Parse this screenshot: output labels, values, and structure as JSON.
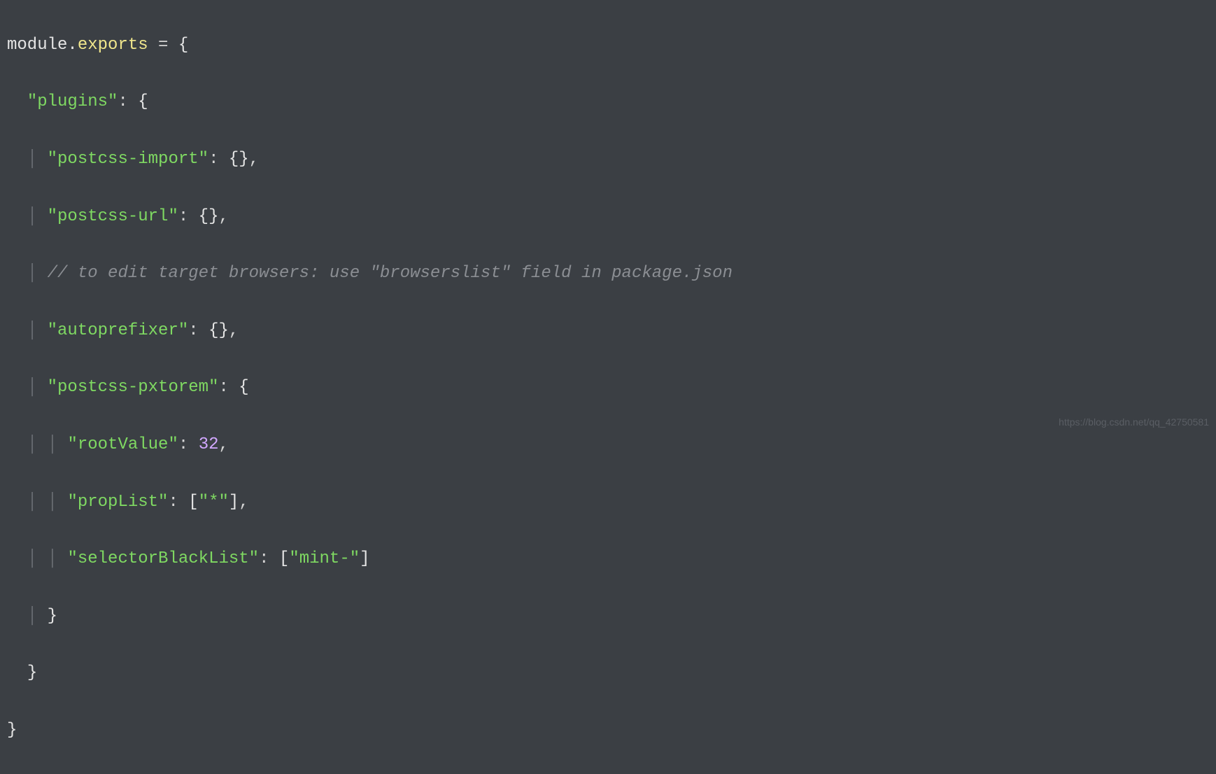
{
  "code": {
    "line1": {
      "module": "module",
      "dot": ".",
      "exports": "exports",
      "equals": " = ",
      "brace": "{"
    },
    "line2": {
      "indent": "  ",
      "key": "\"plugins\"",
      "colon": ": ",
      "brace": "{"
    },
    "line3": {
      "indent": "    ",
      "key": "\"postcss-import\"",
      "colon": ": ",
      "value": "{}",
      "comma": ","
    },
    "line4": {
      "indent": "    ",
      "key": "\"postcss-url\"",
      "colon": ": ",
      "value": "{}",
      "comma": ","
    },
    "line5": {
      "indent": "    ",
      "comment": "// to edit target browsers: use \"browserslist\" field in package.json"
    },
    "line6": {
      "indent": "    ",
      "key": "\"autoprefixer\"",
      "colon": ": ",
      "value": "{}",
      "comma": ","
    },
    "line7": {
      "indent": "    ",
      "key": "\"postcss-pxtorem\"",
      "colon": ": ",
      "brace": "{"
    },
    "line8": {
      "indent": "      ",
      "key": "\"rootValue\"",
      "colon": ": ",
      "value": "32",
      "comma": ","
    },
    "line9": {
      "indent": "      ",
      "key": "\"propList\"",
      "colon": ": ",
      "lbracket": "[",
      "value": "\"*\"",
      "rbracket": "]",
      "comma": ","
    },
    "line10": {
      "indent": "      ",
      "key": "\"selectorBlackList\"",
      "colon": ": ",
      "lbracket": "[",
      "value": "\"mint-\"",
      "rbracket": "]"
    },
    "line11": {
      "indent": "    ",
      "brace": "}"
    },
    "line12": {
      "indent": "  ",
      "brace": "}"
    },
    "line13": {
      "brace": "}"
    }
  },
  "watermark": "https://blog.csdn.net/qq_42750581"
}
